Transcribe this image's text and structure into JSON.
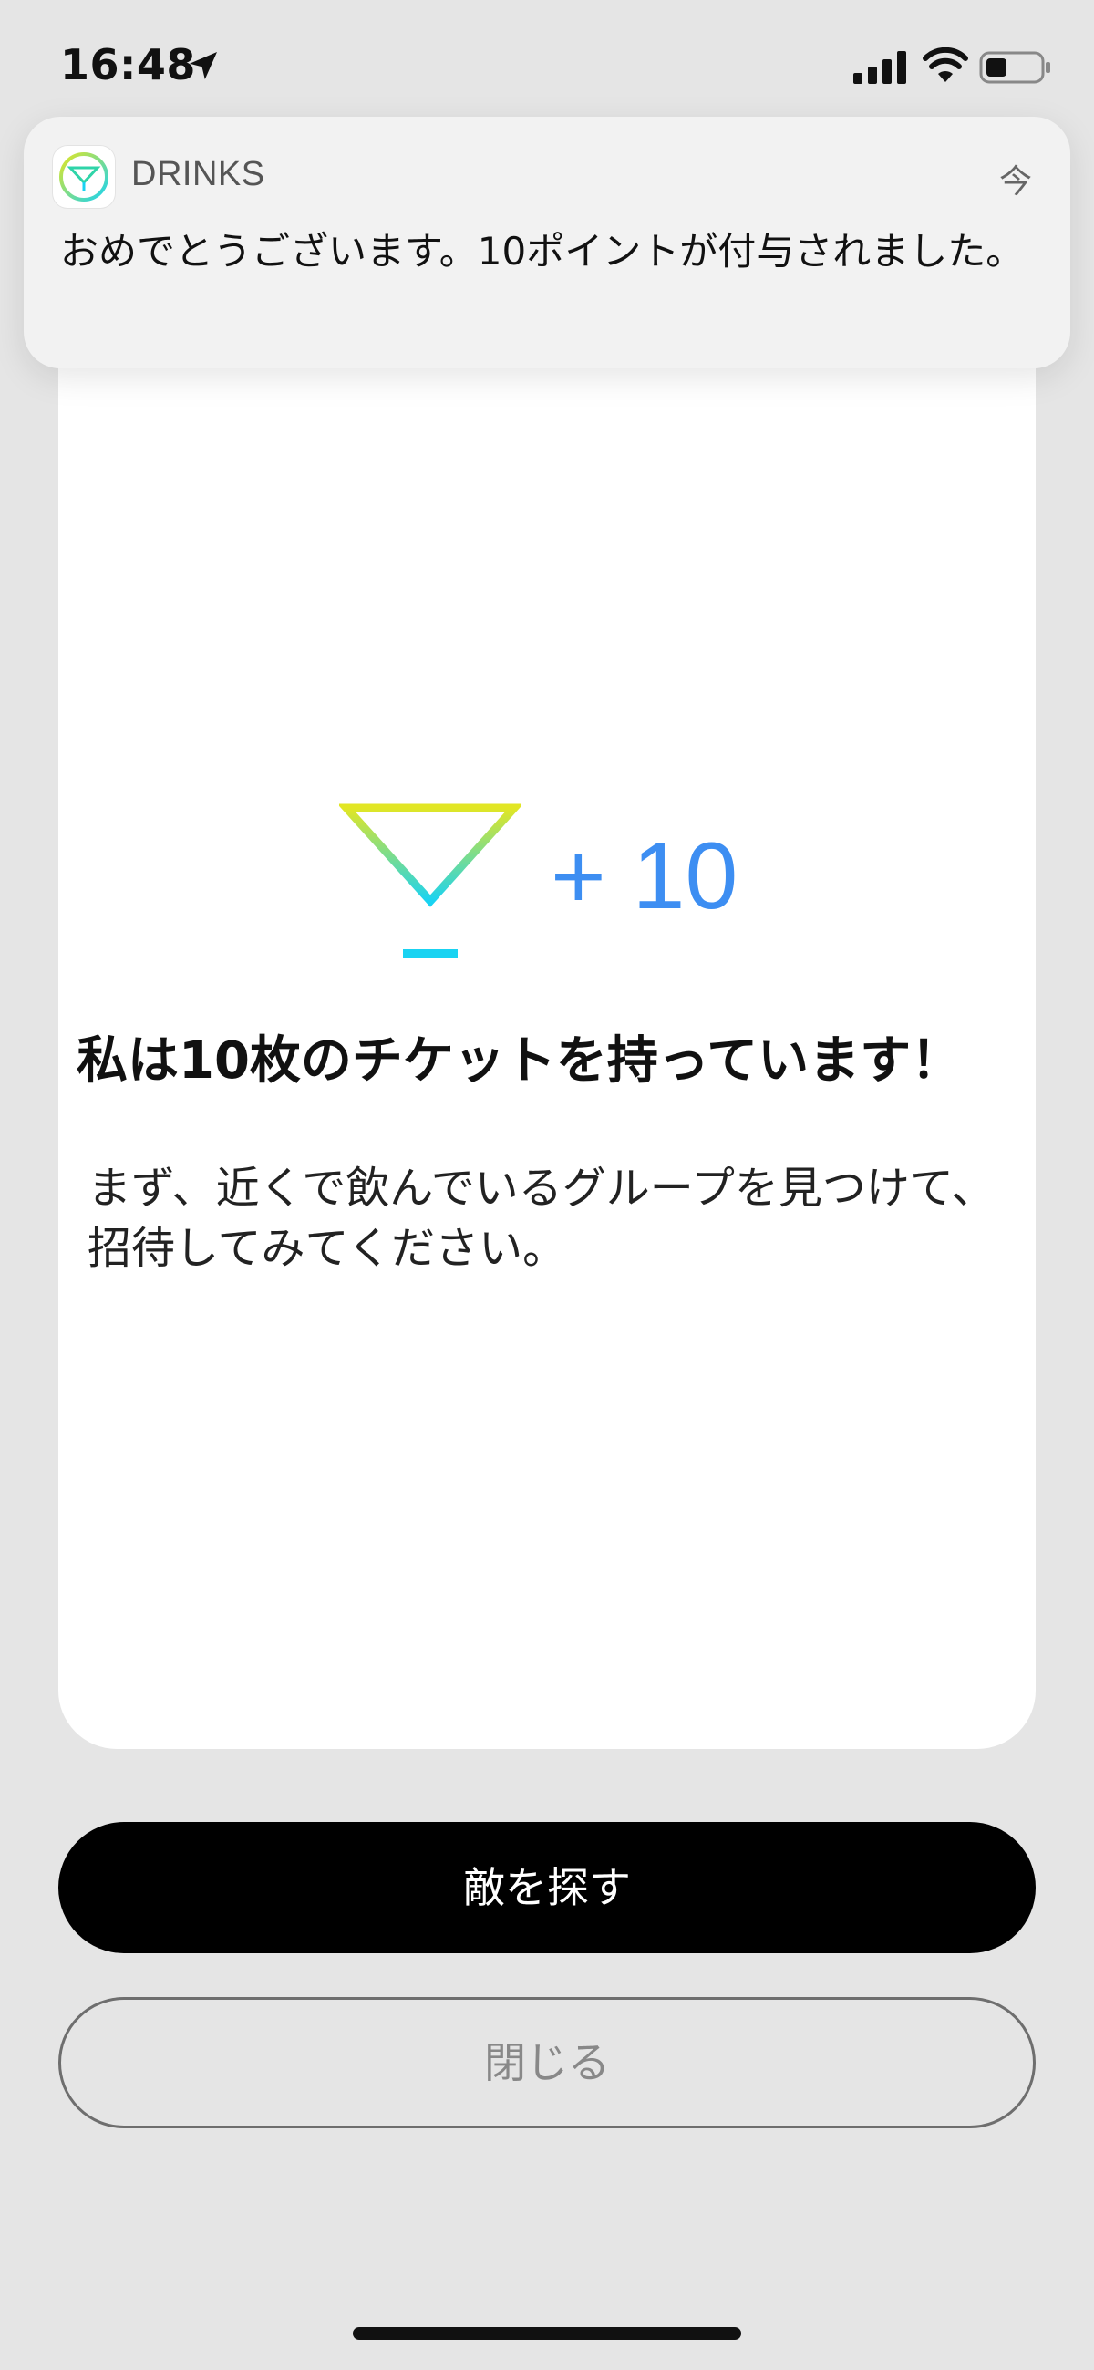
{
  "status_bar": {
    "time": "16:48",
    "icons": [
      "location-arrow-icon",
      "signal-icon",
      "wifi-icon",
      "battery-icon"
    ]
  },
  "notification": {
    "app_icon": "drinks-cocktail-icon",
    "app_name": "DRINKS",
    "time": "今",
    "message": "おめでとうございます。10ポイントが付与されました。"
  },
  "card": {
    "reward_icon": "cocktail-glass-icon",
    "reward_amount": "+ 10",
    "title": "私は10枚のチケットを持っています！",
    "message": "まず、近くで飲んでいるグループを見つけて、招待してみてください。"
  },
  "buttons": {
    "primary_label": "敵を探す",
    "secondary_label": "閉じる"
  },
  "colors": {
    "accent_blue": "#3d8ef2",
    "glass_gradient_top": "#e2e624",
    "glass_gradient_bottom": "#19d3f2",
    "background": "#e5e5e5",
    "primary_button": "#000000"
  }
}
